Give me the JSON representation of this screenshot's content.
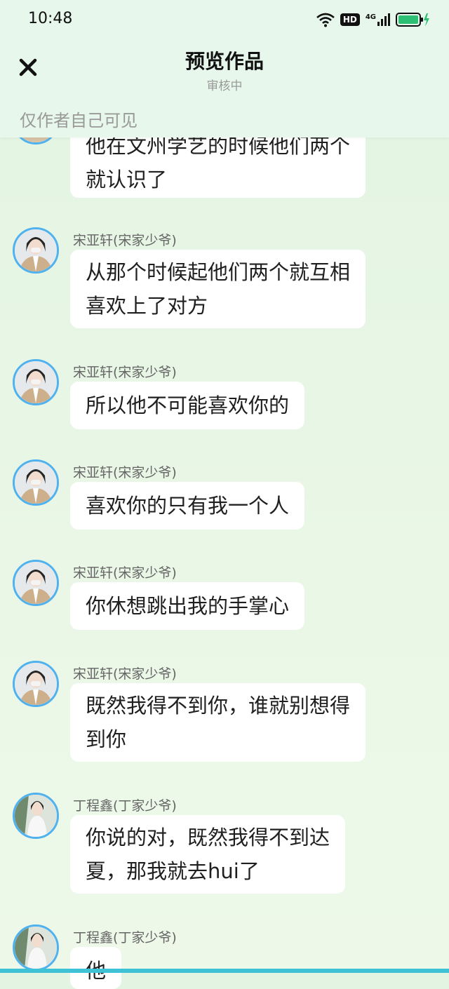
{
  "status_bar": {
    "time": "10:48",
    "hd": "HD",
    "network": "4G"
  },
  "header": {
    "title": "预览作品",
    "subtitle": "审核中",
    "visibility_note": "仅作者自己可见"
  },
  "colors": {
    "accent_border": "#4fb2ee",
    "background": "#e3f4e3",
    "bubble": "#ffffff",
    "battery": "#2dbf73"
  },
  "messages": [
    {
      "name": "",
      "text": "他在文州学艺的时候他们两个\n就认识了",
      "avatar": "partial"
    },
    {
      "name": "宋亚轩(宋家少爷)",
      "text": "从那个时候起他们两个就互相\n喜欢上了对方",
      "avatar": "song"
    },
    {
      "name": "宋亚轩(宋家少爷)",
      "text": "所以他不可能喜欢你的",
      "avatar": "song"
    },
    {
      "name": "宋亚轩(宋家少爷)",
      "text": "喜欢你的只有我一个人",
      "avatar": "song"
    },
    {
      "name": "宋亚轩(宋家少爷)",
      "text": "你休想跳出我的手掌心",
      "avatar": "song"
    },
    {
      "name": "宋亚轩(宋家少爷)",
      "text": "既然我得不到你，谁就别想得\n到你",
      "avatar": "song"
    },
    {
      "name": "丁程鑫(丁家少爷)",
      "text": "你说的对，既然我得不到达\n夏，那我就去hui了",
      "avatar": "ding"
    },
    {
      "name": "丁程鑫(丁家少爷)",
      "text": "他",
      "avatar": "ding"
    }
  ]
}
